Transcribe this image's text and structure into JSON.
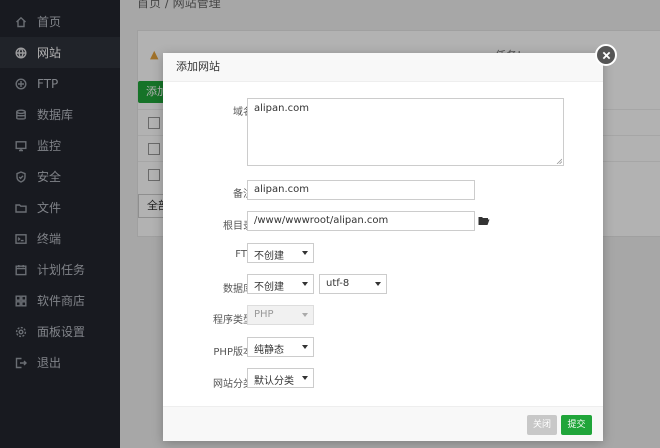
{
  "sidebar": {
    "items": [
      {
        "label": "首页",
        "icon": "home-icon"
      },
      {
        "label": "网站",
        "icon": "globe-icon",
        "active": true
      },
      {
        "label": "FTP",
        "icon": "ftp-icon"
      },
      {
        "label": "数据库",
        "icon": "database-icon"
      },
      {
        "label": "监控",
        "icon": "monitor-icon"
      },
      {
        "label": "安全",
        "icon": "shield-icon"
      },
      {
        "label": "文件",
        "icon": "folder-icon"
      },
      {
        "label": "终端",
        "icon": "terminal-icon"
      },
      {
        "label": "计划任务",
        "icon": "calendar-icon"
      },
      {
        "label": "软件商店",
        "icon": "grid-icon"
      },
      {
        "label": "面板设置",
        "icon": "gear-icon"
      },
      {
        "label": "退出",
        "icon": "logout-icon"
      }
    ]
  },
  "main": {
    "breadcrumb": "首页 / 网站管理",
    "warning_tail": "任务!",
    "add_label": "添加",
    "select_all_label": "全部"
  },
  "modal": {
    "title": "添加网站",
    "domain": {
      "label": "域名",
      "value": "alipan.com"
    },
    "remark": {
      "label": "备注",
      "value": "alipan.com"
    },
    "root": {
      "label": "根目录",
      "value": "/www/wwwroot/alipan.com"
    },
    "ftp": {
      "label": "FTP",
      "value": "不创建"
    },
    "database": {
      "label": "数据库",
      "value": "不创建",
      "charset": "utf-8"
    },
    "program": {
      "label": "程序类型",
      "value": "PHP"
    },
    "php_version": {
      "label": "PHP版本",
      "value": "纯静态"
    },
    "category": {
      "label": "网站分类",
      "value": "默认分类"
    },
    "close_label": "关闭",
    "submit_label": "提交"
  },
  "colors": {
    "brand_green": "#20a53a",
    "sidebar_bg": "#23262e",
    "warning": "#e6a23c"
  }
}
